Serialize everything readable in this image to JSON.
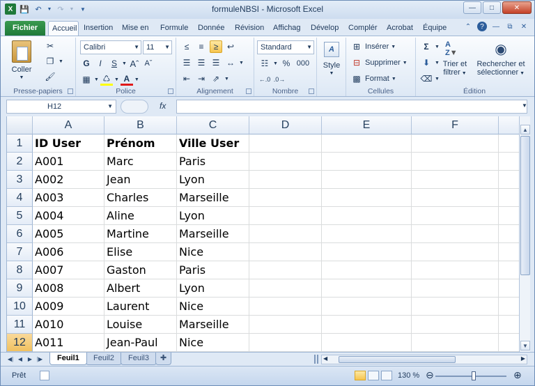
{
  "window": {
    "title": "formuleNBSI - Microsoft Excel"
  },
  "ribbon_tabs": [
    "Fichier",
    "Accueil",
    "Insertion",
    "Mise en",
    "Formule",
    "Donnée",
    "Révision",
    "Affichag",
    "Dévelop",
    "Complér",
    "Acrobat",
    "Équipe"
  ],
  "ribbon": {
    "clipboard": {
      "paste_label": "Coller",
      "group": "Presse-papiers"
    },
    "font": {
      "name": "Calibri",
      "size": "11",
      "group": "Police"
    },
    "alignment": {
      "group": "Alignement"
    },
    "number": {
      "format": "Standard",
      "group": "Nombre",
      "percent": "%",
      "thousands": "000"
    },
    "style": {
      "label": "Style"
    },
    "cells": {
      "insert": "Insérer",
      "delete": "Supprimer",
      "format": "Format",
      "group": "Cellules"
    },
    "editing": {
      "sort_line1": "Trier et",
      "sort_line2": "filtrer",
      "find_line1": "Rechercher et",
      "find_line2": "sélectionner",
      "group": "Édition"
    }
  },
  "formula_bar": {
    "name_box": "H12",
    "fx": "fx",
    "value": ""
  },
  "sheet": {
    "columns": [
      "A",
      "B",
      "C",
      "D",
      "E",
      "F"
    ],
    "rows": [
      {
        "n": "1",
        "cells": [
          "ID User",
          "Prénom",
          "Ville User"
        ]
      },
      {
        "n": "2",
        "cells": [
          "A001",
          "Marc",
          "Paris"
        ]
      },
      {
        "n": "3",
        "cells": [
          "A002",
          "Jean",
          "Lyon"
        ]
      },
      {
        "n": "4",
        "cells": [
          "A003",
          "Charles",
          "Marseille"
        ]
      },
      {
        "n": "5",
        "cells": [
          "A004",
          "Aline",
          "Lyon"
        ]
      },
      {
        "n": "6",
        "cells": [
          "A005",
          "Martine",
          "Marseille"
        ]
      },
      {
        "n": "7",
        "cells": [
          "A006",
          "Elise",
          "Nice"
        ]
      },
      {
        "n": "8",
        "cells": [
          "A007",
          "Gaston",
          "Paris"
        ]
      },
      {
        "n": "9",
        "cells": [
          "A008",
          "Albert",
          "Lyon"
        ]
      },
      {
        "n": "10",
        "cells": [
          "A009",
          "Laurent",
          "Nice"
        ]
      },
      {
        "n": "11",
        "cells": [
          "A010",
          "Louise",
          "Marseille"
        ]
      },
      {
        "n": "12",
        "cells": [
          "A011",
          "Jean-Paul",
          "Nice"
        ]
      }
    ]
  },
  "sheet_tabs": [
    "Feuil1",
    "Feuil2",
    "Feuil3"
  ],
  "status": {
    "ready": "Prêt",
    "zoom": "130 %"
  }
}
